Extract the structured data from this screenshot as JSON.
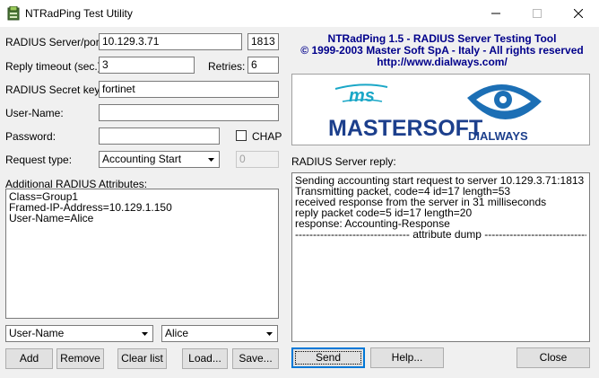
{
  "window": {
    "title": "NTRadPing Test Utility"
  },
  "form": {
    "server_label": "RADIUS Server/port:",
    "server_value": "10.129.3.71",
    "port_value": "1813",
    "timeout_label": "Reply timeout (sec.):",
    "timeout_value": "3",
    "retries_label": "Retries:",
    "retries_value": "6",
    "secret_label": "RADIUS Secret key:",
    "secret_value": "fortinet",
    "username_label": "User-Name:",
    "username_value": "",
    "password_label": "Password:",
    "password_value": "",
    "chap_label": "CHAP",
    "request_type_label": "Request type:",
    "request_type_value": "Accounting Start",
    "request_type_extra": "0",
    "attributes_label": "Additional RADIUS Attributes:",
    "attributes": [
      "Class=Group1",
      "Framed-IP-Address=10.129.1.150",
      "User-Name=Alice"
    ],
    "attr_name_value": "User-Name",
    "attr_value_value": "Alice"
  },
  "buttons": {
    "add": "Add",
    "remove": "Remove",
    "clear": "Clear list",
    "load": "Load...",
    "save": "Save...",
    "send": "Send",
    "help": "Help...",
    "close": "Close"
  },
  "header": {
    "line1": "NTRadPing 1.5 - RADIUS Server Testing Tool",
    "line2": "© 1999-2003 Master Soft SpA - Italy - All rights reserved",
    "line3": "http://www.dialways.com/"
  },
  "logo": {
    "ms": "ms",
    "mastersoft": "MASTERSOFT",
    "dialways": "DIALWAYS"
  },
  "reply": {
    "label": "RADIUS Server reply:",
    "lines": [
      "Sending accounting start request to server 10.129.3.71:1813",
      "Transmitting packet, code=4 id=17 length=53",
      "received response from the server in 31 milliseconds",
      "reply packet code=5 id=17 length=20",
      "response: Accounting-Response",
      "-------------------------------- attribute dump ------------------------------"
    ]
  },
  "colors": {
    "header_text": "#00008b",
    "mastersoft_blue": "#1c3f8c",
    "dialways_blue": "#1c6fb5",
    "ms_teal": "#1aa7c7"
  }
}
